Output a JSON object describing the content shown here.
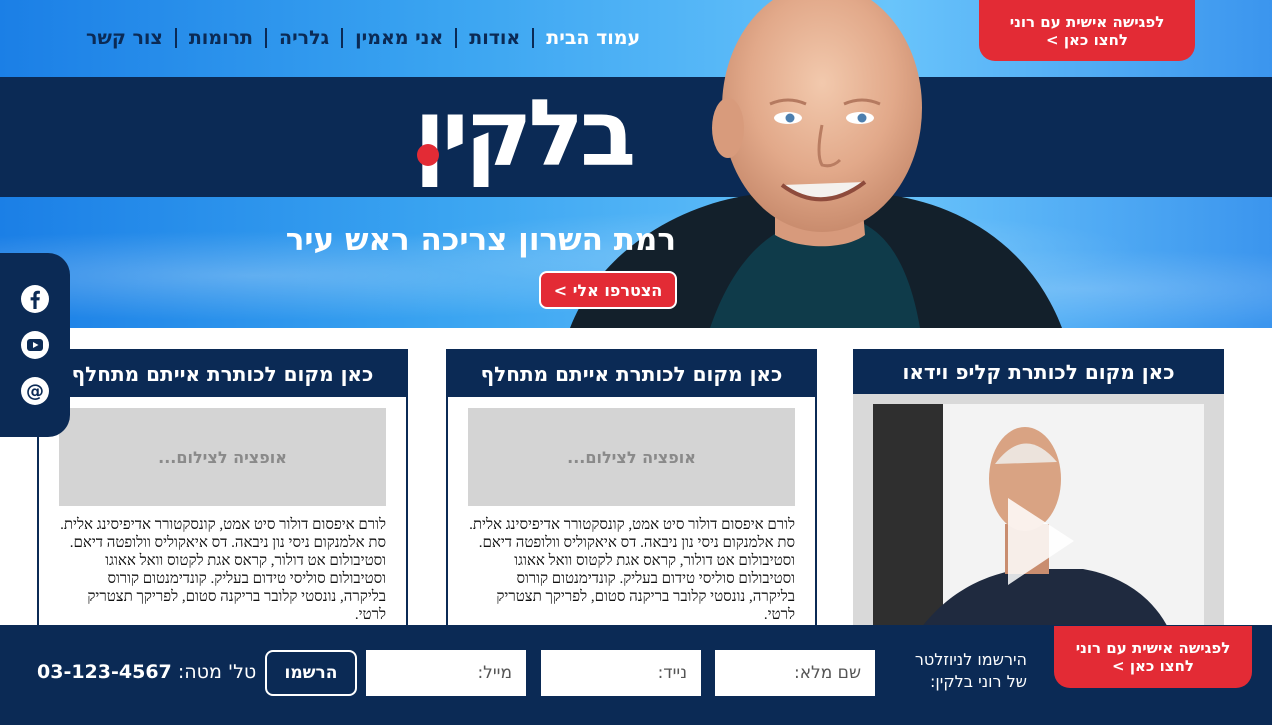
{
  "nav": {
    "items": [
      {
        "label": "עמוד הבית",
        "active": true
      },
      {
        "label": "אודות",
        "active": false
      },
      {
        "label": "אני מאמין",
        "active": false
      },
      {
        "label": "גלריה",
        "active": false
      },
      {
        "label": "תרומות",
        "active": false
      },
      {
        "label": "צור קשר",
        "active": false
      }
    ]
  },
  "hero": {
    "logo": "בלקין",
    "tagline": "רמת השרון צריכה ראש עיר",
    "join_button": "הצטרפו אלי >"
  },
  "cta_top": {
    "line1": "לפגישה אישית עם רוני",
    "line2": "לחצו כאן >"
  },
  "social": {
    "icons": [
      "facebook-icon",
      "youtube-icon",
      "email-icon"
    ]
  },
  "video_card": {
    "title": "כאן מקום לכותרת קליפ וידאו"
  },
  "cards": [
    {
      "title": "כאן מקום לכותרת אייתם מתחלף",
      "photo_placeholder": "אופציה לצילום...",
      "text": "לורם איפסום דולור סיט אמט, קונסקטורר אדיפיסינג אלית. סת אלמנקום ניסי נון ניבאה. דס איאקוליס וולופטה דיאם. וסטיבולום אט דולור, קראס אגת לקטוס וואל אאוגו וסטיבולום סוליסי טידום בעליק. קונדימנטום קורוס בליקרה, נונסטי קלובר בריקנה סטום, לפריקך תצטריק לרטי."
    },
    {
      "title": "כאן מקום לכותרת אייתם מתחלף",
      "photo_placeholder": "אופציה לצילום...",
      "text": "לורם איפסום דולור סיט אמט, קונסקטורר אדיפיסינג אלית. סת אלמנקום ניסי נון ניבאה. דס איאקוליס וולופטה דיאם. וסטיבולום אט דולור, קראס אגת לקטוס וואל אאוגו וסטיבולום סוליסי טידום בעליק. קונדימנטום קורוס בליקרה, נונסטי קלובר בריקנה סטום, לפריקך תצטריק לרטי."
    }
  ],
  "footer": {
    "newsletter_label": "הירשמו לניוזלטר של רוני בלקין:",
    "name_placeholder": "שם מלא:",
    "phone_placeholder": "נייד:",
    "email_placeholder": "מייל:",
    "register_button": "הרשמו",
    "hq_label": "טל' מטה:",
    "hq_phone": "03-123-4567"
  },
  "cta_bottom": {
    "line1": "לפגישה אישית עם רוני",
    "line2": "לחצו כאן >"
  },
  "colors": {
    "navy": "#0b2a55",
    "red": "#e32b35",
    "sky": "#3aa4f1"
  }
}
